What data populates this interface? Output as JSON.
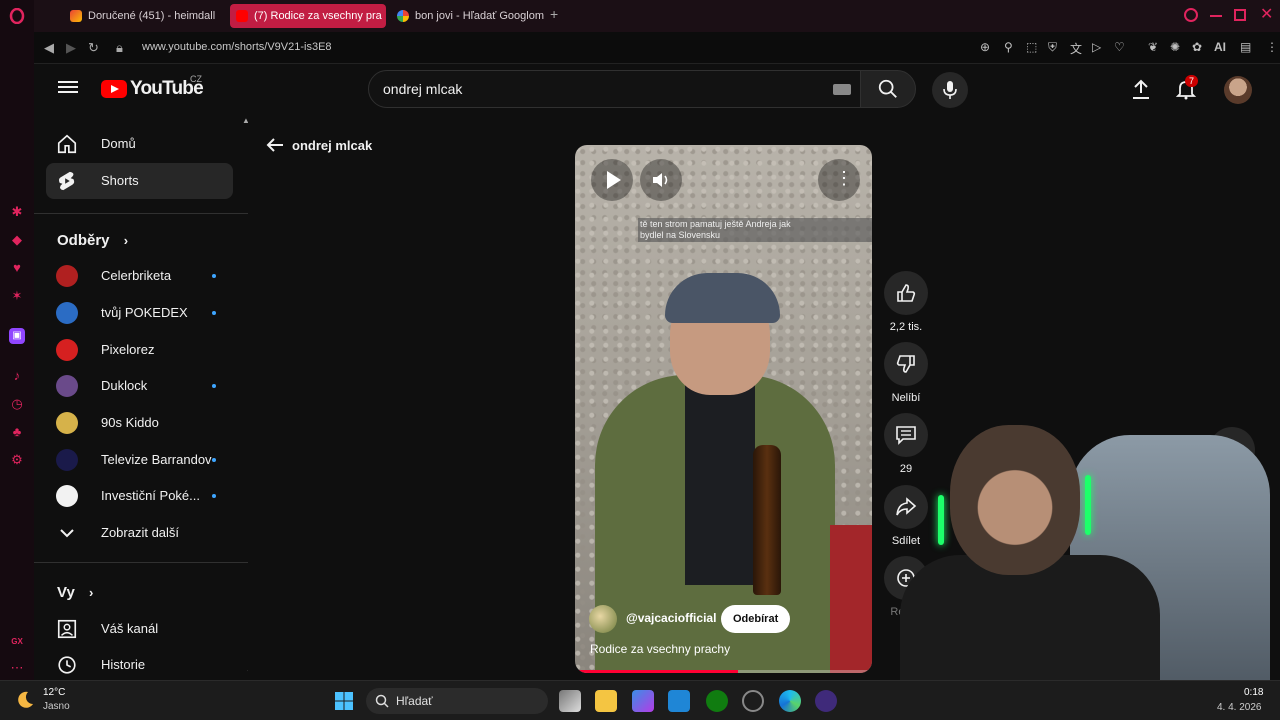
{
  "browser": {
    "tabs": [
      {
        "title": "Doručené (451) - heimdall",
        "active": false
      },
      {
        "title": "(7) Rodice za vsechny pra",
        "active": true
      },
      {
        "title": "bon jovi - Hľadať Googlom",
        "active": false
      }
    ],
    "new_tab_label": "+",
    "url": "www.youtube.com/shorts/V9V21-is3E8",
    "ai_label": "AI",
    "gx_label": "GX"
  },
  "header": {
    "logo_text": "YouTube",
    "country": "CZ",
    "search_value": "ondrej mlcak",
    "notification_count": "7"
  },
  "sidebar": {
    "main": [
      {
        "label": "Domů",
        "active": false
      },
      {
        "label": "Shorts",
        "active": true
      }
    ],
    "subscriptions_title": "Odběry",
    "subscriptions": [
      {
        "label": "Celerbriketa",
        "dot": true,
        "color": "#b02020"
      },
      {
        "label": "tvůj POKEDEX",
        "dot": true,
        "color": "#2b6cc4"
      },
      {
        "label": "Pixelorez",
        "dot": false,
        "color": "#d62020"
      },
      {
        "label": "Duklock",
        "dot": true,
        "color": "#6a4a8a"
      },
      {
        "label": "90s Kiddo",
        "dot": false,
        "color": "#d6b24a"
      },
      {
        "label": "Televize Barrandov",
        "dot": true,
        "color": "#1a1a4a"
      },
      {
        "label": "Investiční Poké...",
        "dot": true,
        "color": "#f2f2f2"
      }
    ],
    "show_more": "Zobrazit další",
    "you_title": "Vy",
    "you_items": [
      {
        "label": "Váš kanál"
      },
      {
        "label": "Historie"
      }
    ]
  },
  "main": {
    "back_label": "ondrej mlcak"
  },
  "short": {
    "caption_line1": "tě ten strom pamatuj ještě Andreja jak",
    "caption_line2": "bydlel na Slovensku",
    "channel": "@vajcaciofficial",
    "subscribe_label": "Odebírat",
    "title": "Rodice za vsechny prachy",
    "progress": 0.55
  },
  "actions": {
    "like_count": "2,2 tis.",
    "dislike_label": "Nelíbí",
    "comments_count": "29",
    "share_label": "Sdílet",
    "remix_label": "Remix"
  },
  "taskbar": {
    "temperature": "12°C",
    "condition": "Jasno",
    "search_placeholder": "Hľadať",
    "time": "0:18",
    "date": "4. 4. 2026"
  },
  "colors": {
    "accent": "#ff0000",
    "opera_accent": "#e0245e",
    "subscription_dot": "#3ea6ff"
  }
}
